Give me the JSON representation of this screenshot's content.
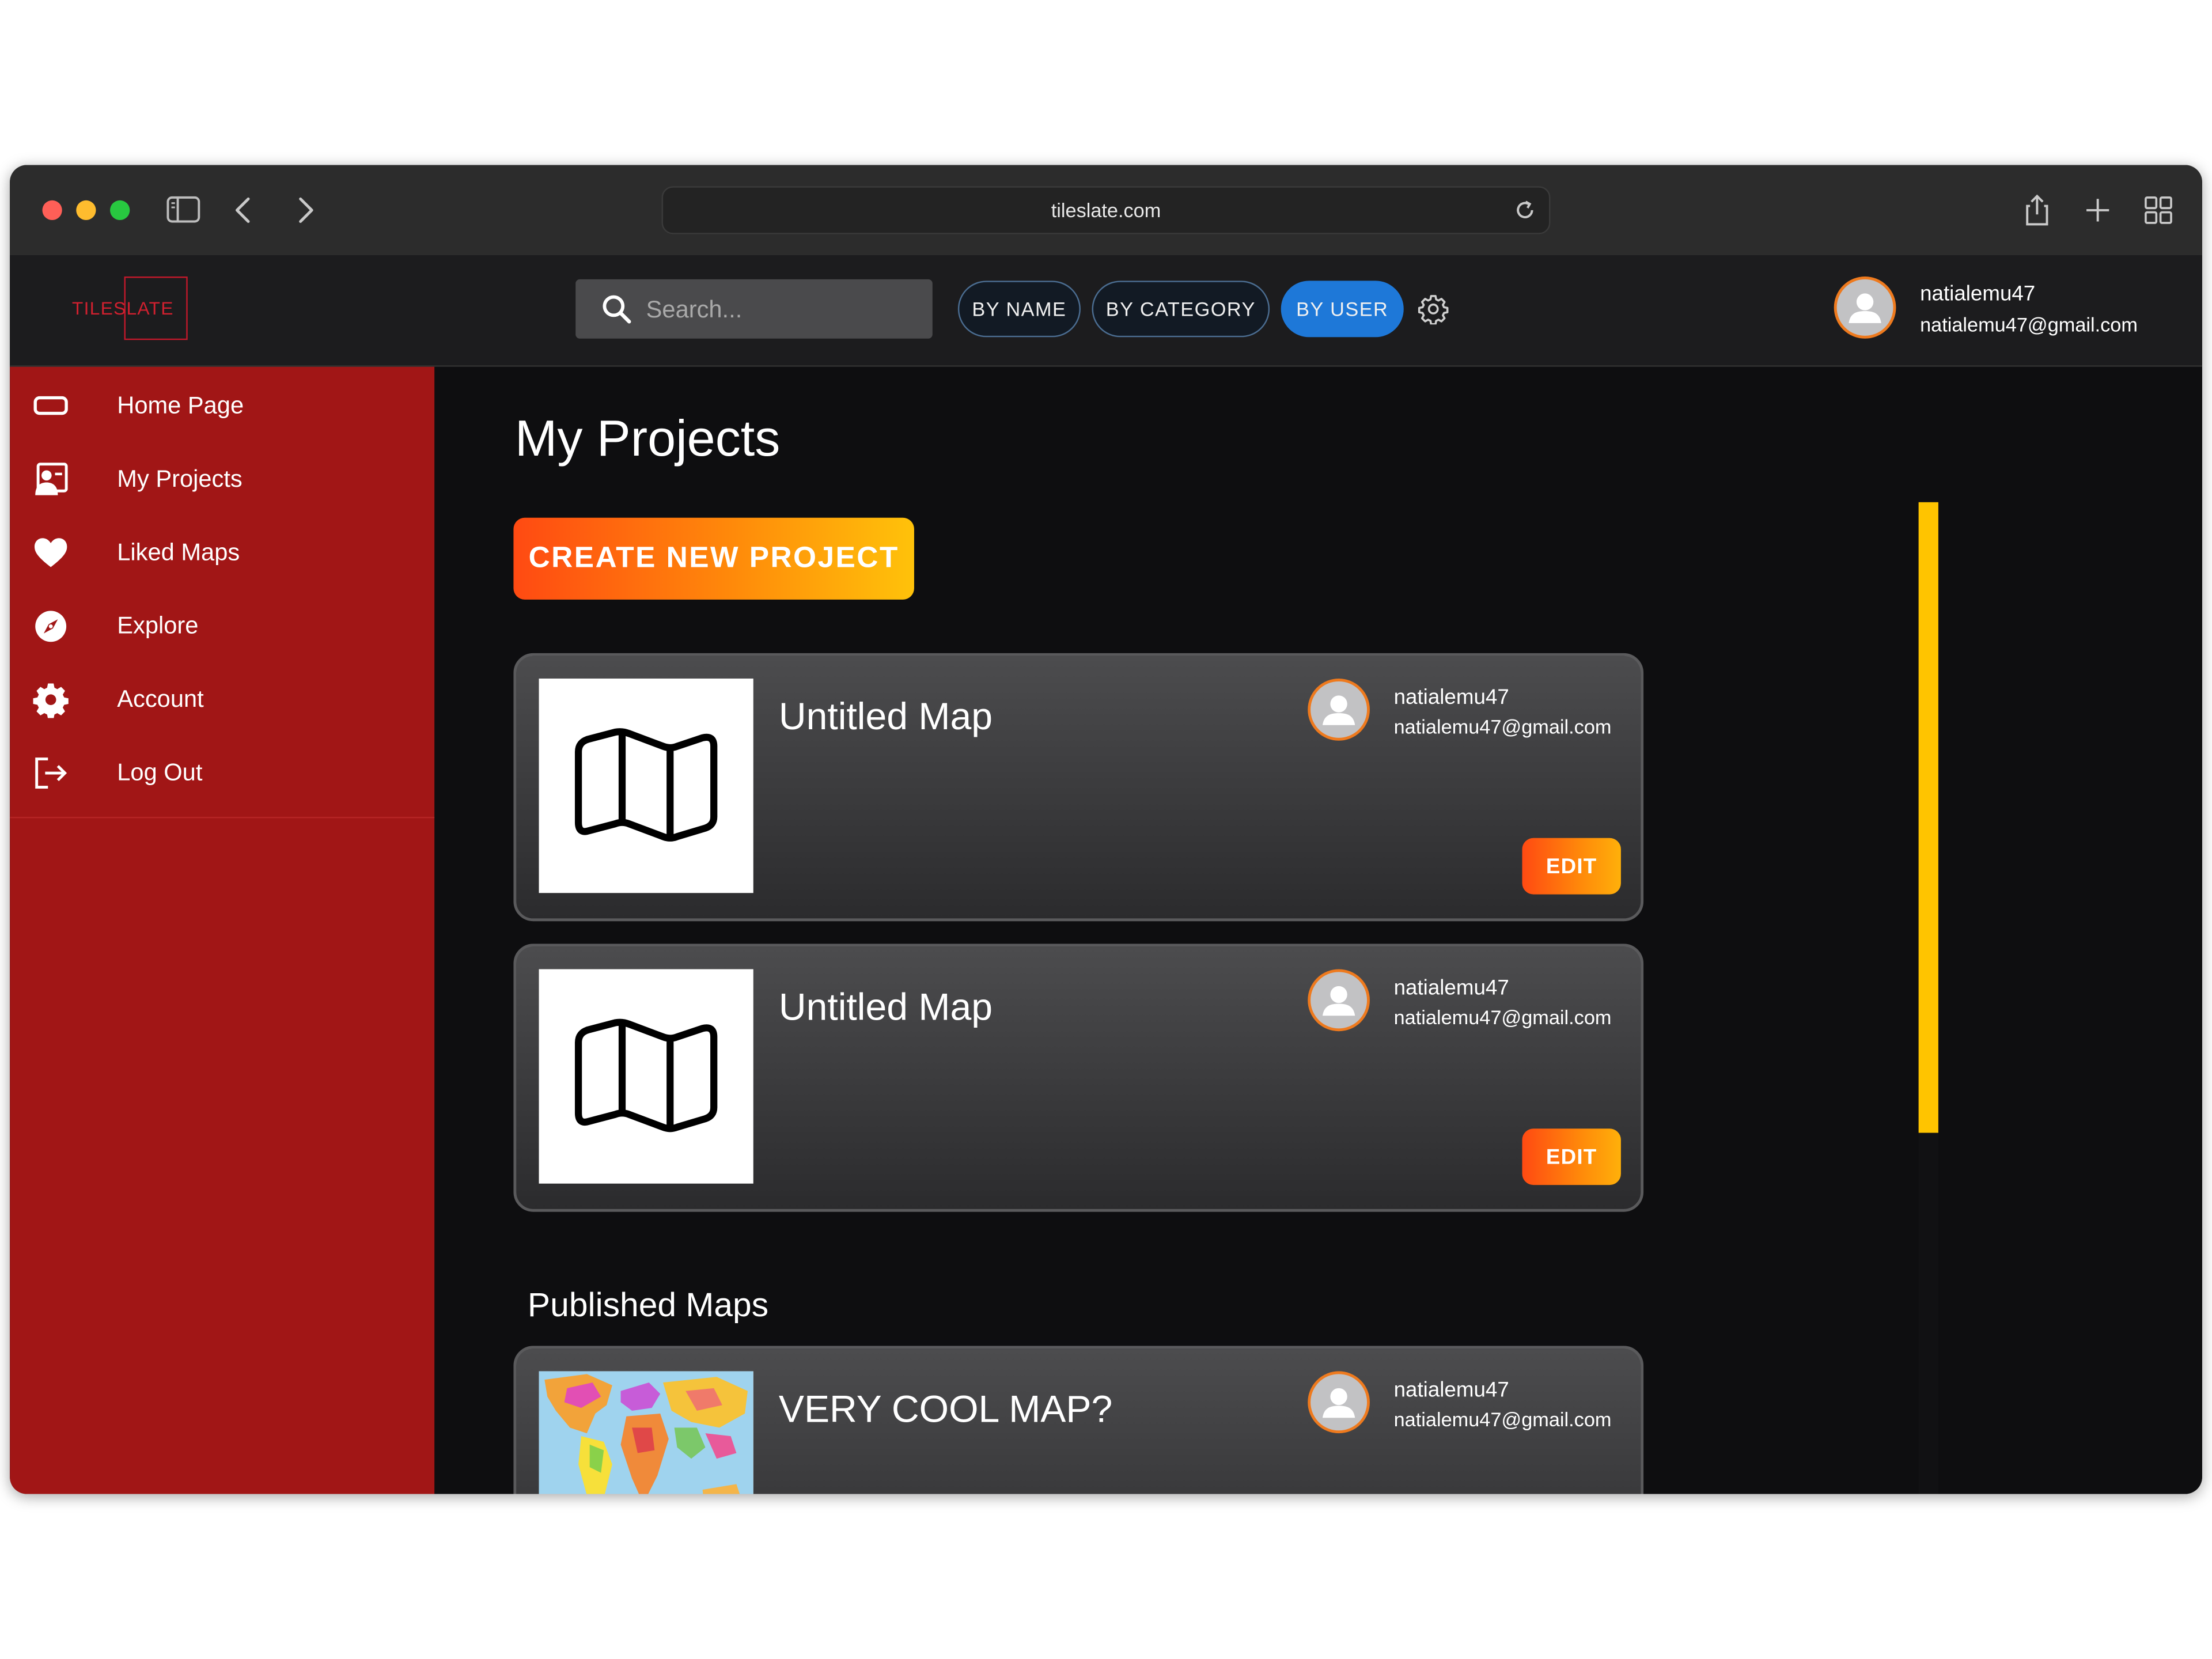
{
  "browser": {
    "url": "tileslate.com"
  },
  "header": {
    "logo_text": "TILESLATE",
    "search": {
      "placeholder": "Search..."
    },
    "filters": [
      {
        "label": "BY NAME",
        "active": false
      },
      {
        "label": "BY CATEGORY",
        "active": false
      },
      {
        "label": "BY USER",
        "active": true
      }
    ],
    "user": {
      "username": "natialemu47",
      "email": "natialemu47@gmail.com"
    }
  },
  "sidebar": {
    "items": [
      {
        "label": "Home Page",
        "icon": "home-icon"
      },
      {
        "label": "My Projects",
        "icon": "projects-icon"
      },
      {
        "label": "Liked Maps",
        "icon": "heart-icon"
      },
      {
        "label": "Explore",
        "icon": "compass-icon"
      },
      {
        "label": "Account",
        "icon": "gear-icon"
      },
      {
        "label": "Log Out",
        "icon": "logout-icon"
      }
    ]
  },
  "main": {
    "title": "My Projects",
    "create_button": "CREATE NEW PROJECT",
    "projects": [
      {
        "title": "Untitled Map",
        "thumbnail": "map-icon",
        "username": "natialemu47",
        "email": "natialemu47@gmail.com",
        "edit_label": "EDIT"
      },
      {
        "title": "Untitled Map",
        "thumbnail": "map-icon",
        "username": "natialemu47",
        "email": "natialemu47@gmail.com",
        "edit_label": "EDIT"
      }
    ],
    "published_title": "Published Maps",
    "published": [
      {
        "title": "VERY COOL MAP?",
        "thumbnail": "world-map-image",
        "username": "natialemu47",
        "email": "natialemu47@gmail.com"
      }
    ]
  },
  "colors": {
    "sidebar": "#a11616",
    "background": "#0e0e10",
    "accent_orange": "#ff6a10",
    "accent_yellow": "#ffc400",
    "active_filter": "#1e78d8"
  }
}
